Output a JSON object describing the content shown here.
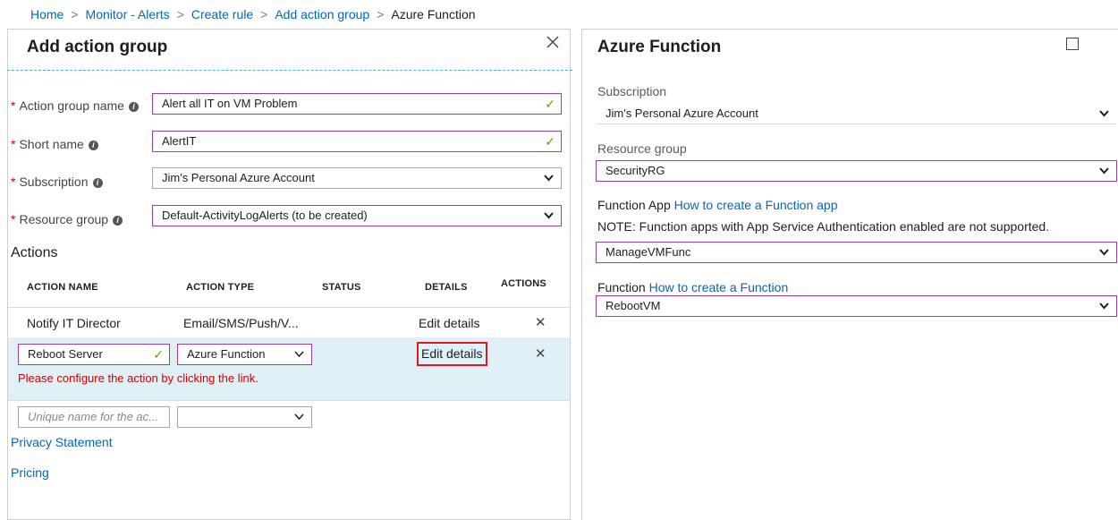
{
  "breadcrumb": {
    "items": [
      "Home",
      "Monitor - Alerts",
      "Create rule",
      "Add action group"
    ],
    "current": "Azure Function"
  },
  "left_panel": {
    "title": "Add action group",
    "fields": [
      {
        "label": "Action group name",
        "value": "Alert all IT on VM Problem",
        "control": "text",
        "valid": true
      },
      {
        "label": "Short name",
        "value": "AlertIT",
        "control": "text",
        "valid": true
      },
      {
        "label": "Subscription",
        "value": "Jim's Personal Azure Account",
        "control": "select"
      },
      {
        "label": "Resource group",
        "value": "Default-ActivityLogAlerts (to be created)",
        "control": "select"
      }
    ],
    "actions_heading": "Actions",
    "table": {
      "columns": [
        "ACTION NAME",
        "ACTION TYPE",
        "STATUS",
        "DETAILS",
        "ACTIONS"
      ],
      "rows": [
        {
          "name": "Notify IT Director",
          "type": "Email/SMS/Push/V...",
          "status": "",
          "details": "Edit details"
        },
        {
          "name": "Reboot Server",
          "type": "Azure Function",
          "status": "",
          "details": "Edit details",
          "error": "Please configure the action by clicking the link."
        }
      ],
      "new_row": {
        "name_placeholder": "Unique name for the ac...",
        "type_value": ""
      }
    },
    "links": {
      "privacy": "Privacy Statement",
      "pricing": "Pricing"
    }
  },
  "right_panel": {
    "title": "Azure Function",
    "subscription": {
      "label": "Subscription",
      "value": "Jim's Personal Azure Account"
    },
    "resource_group": {
      "label": "Resource group",
      "value": "SecurityRG"
    },
    "function_app": {
      "label": "Function App",
      "link": "How to create a Function app",
      "note": "NOTE: Function apps with App Service Authentication enabled are not supported.",
      "value": "ManageVMFunc"
    },
    "function": {
      "label": "Function",
      "link": "How to create a Function",
      "value": "RebootVM"
    }
  },
  "colors": {
    "accent": "#0066c0",
    "selected_border": "#9b3ea0",
    "error": "#d80000",
    "highlight_row": "#dff0f7",
    "valid_check": "#57a300",
    "required": "#cc0000"
  },
  "icons": {
    "close": "close-icon",
    "maximize": "maximize-icon",
    "delete": "delete-icon",
    "check": "checkmark-icon",
    "chevron": "chevron-down-icon",
    "info": "info-icon"
  }
}
